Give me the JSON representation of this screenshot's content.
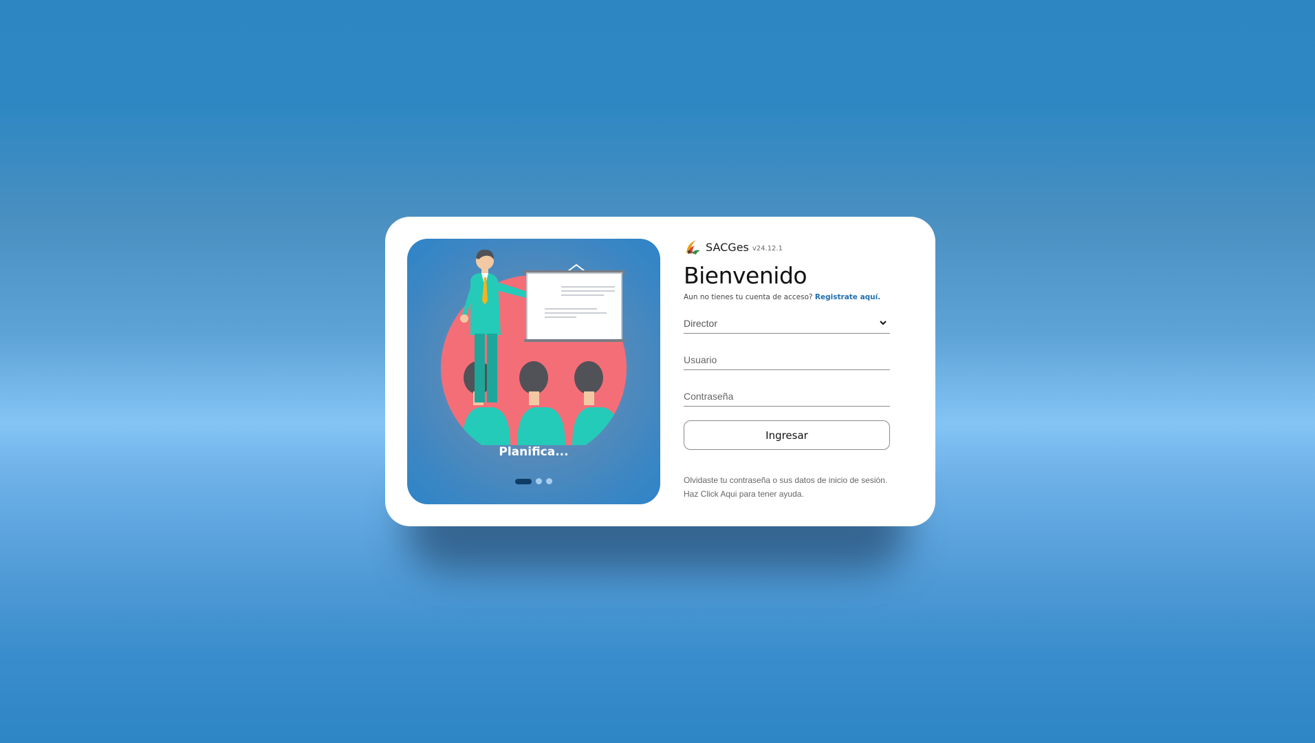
{
  "brand": {
    "name": "SACGes",
    "version": "v24.12.1"
  },
  "login": {
    "title": "Bienvenido",
    "register_prompt": "Aun no tienes tu cuenta de acceso?",
    "register_link": "Registrate aquí.",
    "role_selected": "Director",
    "role_options": [
      "Director"
    ],
    "username_placeholder": "Usuario",
    "password_placeholder": "Contraseña",
    "submit_label": "Ingresar",
    "help_line1": "Olvidaste tu contraseña o sus datos de inicio de sesión.",
    "help_line2": "Haz Click Aqui para tener ayuda."
  },
  "carousel": {
    "caption": "Planifica...",
    "active_index": 0,
    "slide_count": 3
  },
  "colors": {
    "background_top": "#2d85c1",
    "background_mid": "#84c4f5",
    "card": "#ffffff",
    "illustration_circle": "#f46e78",
    "link": "#1f6fae",
    "dot_active": "#0f3c66"
  }
}
